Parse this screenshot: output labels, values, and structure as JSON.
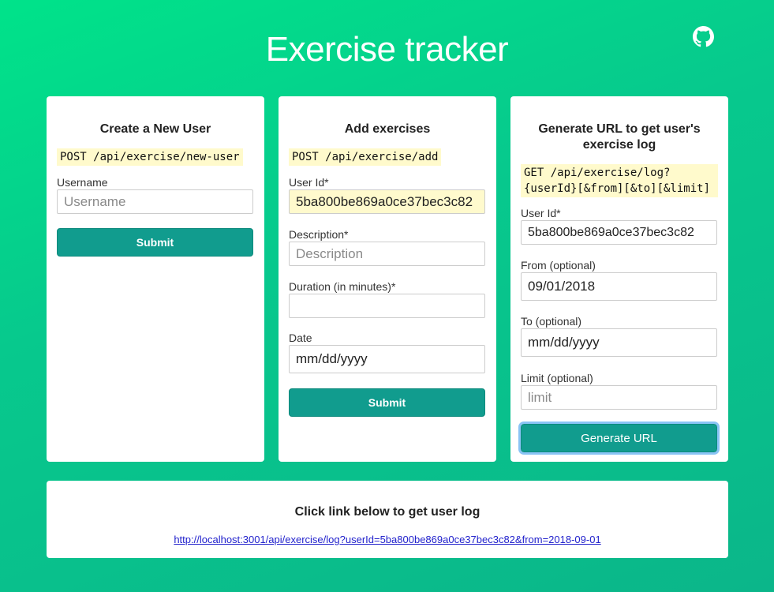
{
  "header": {
    "title": "Exercise tracker",
    "github_icon": "github-icon"
  },
  "new_user": {
    "heading": "Create a New User",
    "endpoint": "POST /api/exercise/new-user",
    "username_label": "Username",
    "username_placeholder": "Username",
    "submit_label": "Submit"
  },
  "add_exercise": {
    "heading": "Add exercises",
    "endpoint": "POST /api/exercise/add",
    "userid_label": "User Id*",
    "userid_value": "5ba800be869a0ce37bec3c82",
    "description_label": "Description*",
    "description_placeholder": "Description",
    "duration_label": "Duration (in minutes)*",
    "duration_value": "",
    "date_label": "Date",
    "date_value": "mm/dd/yyyy",
    "submit_label": "Submit"
  },
  "get_log": {
    "heading_line1": "Generate URL to get user's",
    "heading_line2": "exercise log",
    "endpoint_line1": "GET /api/exercise/log?",
    "endpoint_line2": "{userId}[&from][&to][&limit]",
    "userid_label": "User Id*",
    "userid_value": "5ba800be869a0ce37bec3c82",
    "from_label": "From (optional)",
    "from_value": "09/01/2018",
    "to_label": "To (optional)",
    "to_value": "mm/dd/yyyy",
    "limit_label": "Limit (optional)",
    "limit_placeholder": "limit",
    "generate_label": "Generate URL"
  },
  "result": {
    "heading": "Click link below to get user log",
    "link": "http://localhost:3001/api/exercise/log?userId=5ba800be869a0ce37bec3c82&from=2018-09-01"
  },
  "colors": {
    "background": "#07c98d",
    "button": "#119c8e",
    "code_highlight": "#fffacc",
    "link": "#2222cc"
  }
}
